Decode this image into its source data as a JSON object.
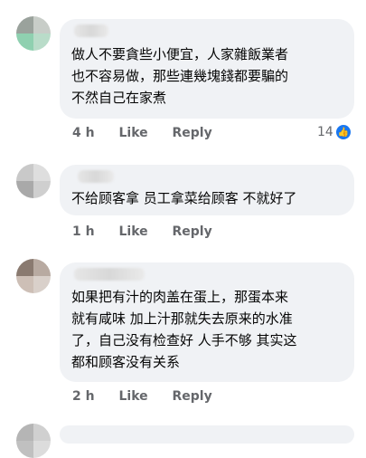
{
  "comments": [
    {
      "text": "做人不要貪些小便宜，人家雜飯業者\n也不容易做，那些連幾塊錢都要騙的\n不然自己在家煮",
      "time": "4 h",
      "like": "Like",
      "reply": "Reply",
      "reaction_count": "14",
      "reaction_icon": "like-icon"
    },
    {
      "text": "不给顾客拿 员工拿菜给顾客 不就好了",
      "time": "1 h",
      "like": "Like",
      "reply": "Reply"
    },
    {
      "text": "如果把有汁的肉盖在蛋上，那蛋本来\n就有咸味 加上汁那就失去原来的水准\n了，自己没有检查好 人手不够 其实这\n都和顾客没有关系",
      "time": "2 h",
      "like": "Like",
      "reply": "Reply"
    }
  ],
  "colors": {
    "bubble": "#f0f2f5",
    "action_text": "#65676b",
    "like_blue": "#1877f2"
  }
}
